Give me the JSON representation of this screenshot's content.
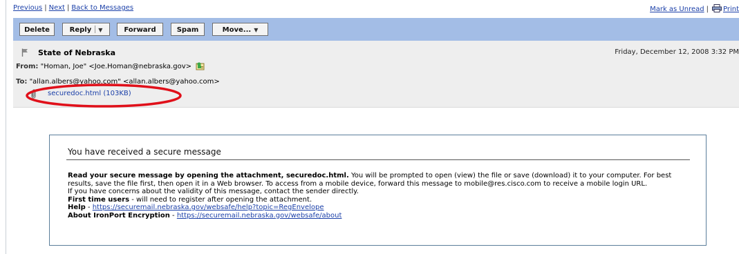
{
  "nav": {
    "previous": "Previous",
    "next": "Next",
    "back": "Back to Messages",
    "mark_unread": "Mark as Unread",
    "print": "Print",
    "separator": "|"
  },
  "toolbar": {
    "delete": "Delete",
    "reply": "Reply",
    "forward": "Forward",
    "spam": "Spam",
    "move": "Move..."
  },
  "message": {
    "subject": "State of Nebraska",
    "date": "Friday, December 12, 2008 3:32 PM",
    "from_label": "From:",
    "from_value": "\"Homan, Joe\" <Joe.Homan@nebraska.gov>",
    "to_label": "To:",
    "to_value": "\"allan.albers@yahoo.com\" <allan.albers@yahoo.com>",
    "attachment": "securedoc.html (103KB)"
  },
  "body": {
    "heading": "You have received a secure message",
    "lead_bold": "Read your secure message by opening the attachment, securedoc.html.",
    "lead_rest": " You will be prompted to open (view) the file or save (download) it to your computer. For best results, save the file first, then open it in a Web browser. To access from a mobile device, forward this message to mobile@res.cisco.com to receive a mobile login URL.",
    "concerns": "If you have concerns about the validity of this message, contact the sender directly.",
    "first_time_bold": "First time users",
    "first_time_rest": " - will need to register after opening the attachment.",
    "help_bold": "Help",
    "help_sep": " - ",
    "help_url": "https://securemail.nebraska.gov/websafe/help?topic=RegEnvelope",
    "about_bold": "About IronPort Encryption",
    "about_sep": " - ",
    "about_url": "https://securemail.nebraska.gov/websafe/about"
  },
  "colors": {
    "toolbar_bg": "#a3bde6",
    "header_bg": "#eeeeee",
    "link": "#1a3fa8",
    "annotation": "#e0101a",
    "box_border": "#5a7d9a"
  }
}
